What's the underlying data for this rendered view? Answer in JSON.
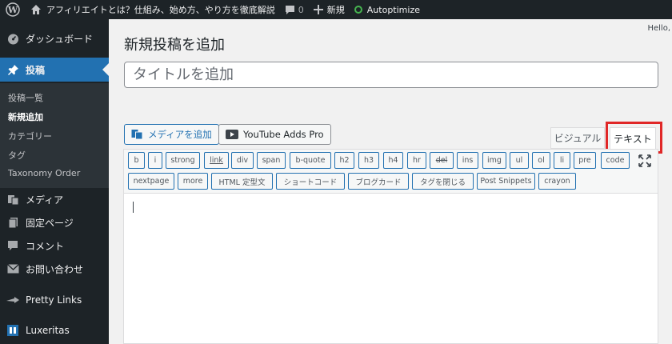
{
  "admin_bar": {
    "site_title": "アフィリエイトとは？仕組み、始め方、やり方を徹底解説",
    "comments_count": "0",
    "new_label": "新規",
    "plugin_label": "Autoptimize",
    "hello": "Hello,"
  },
  "sidebar": {
    "dashboard": "ダッシュボード",
    "posts": "投稿",
    "submenu": {
      "all_posts": "投稿一覧",
      "add_new": "新規追加",
      "categories": "カテゴリー",
      "tags": "タグ",
      "taxonomy_order": "Taxonomy Order"
    },
    "media": "メディア",
    "pages": "固定ページ",
    "comments": "コメント",
    "contact": "お問い合わせ",
    "pretty_links": "Pretty Links",
    "luxeritas": "Luxeritas"
  },
  "main": {
    "page_title": "新規投稿を追加",
    "title_placeholder": "タイトルを追加",
    "add_media": "メディアを追加",
    "youtube": "YouTube Adds Pro",
    "tab_visual": "ビジュアル",
    "tab_text": "テキスト"
  },
  "quicktags_row1": [
    "b",
    "i",
    "strong",
    "link",
    "div",
    "span",
    "b-quote",
    "h2",
    "h3",
    "h4",
    "hr",
    "del",
    "ins",
    "img",
    "ul",
    "ol",
    "li",
    "pre",
    "code"
  ],
  "quicktags_row2": [
    "nextpage",
    "more",
    "HTML 定型文",
    "ショートコード",
    "ブログカード",
    "タグを閉じる",
    "Post Snippets",
    "crayon"
  ],
  "colors": {
    "admin_bg": "#1d2327",
    "accent": "#2271b1",
    "highlight": "#e02727",
    "autoptimize_status": "#46b450"
  }
}
